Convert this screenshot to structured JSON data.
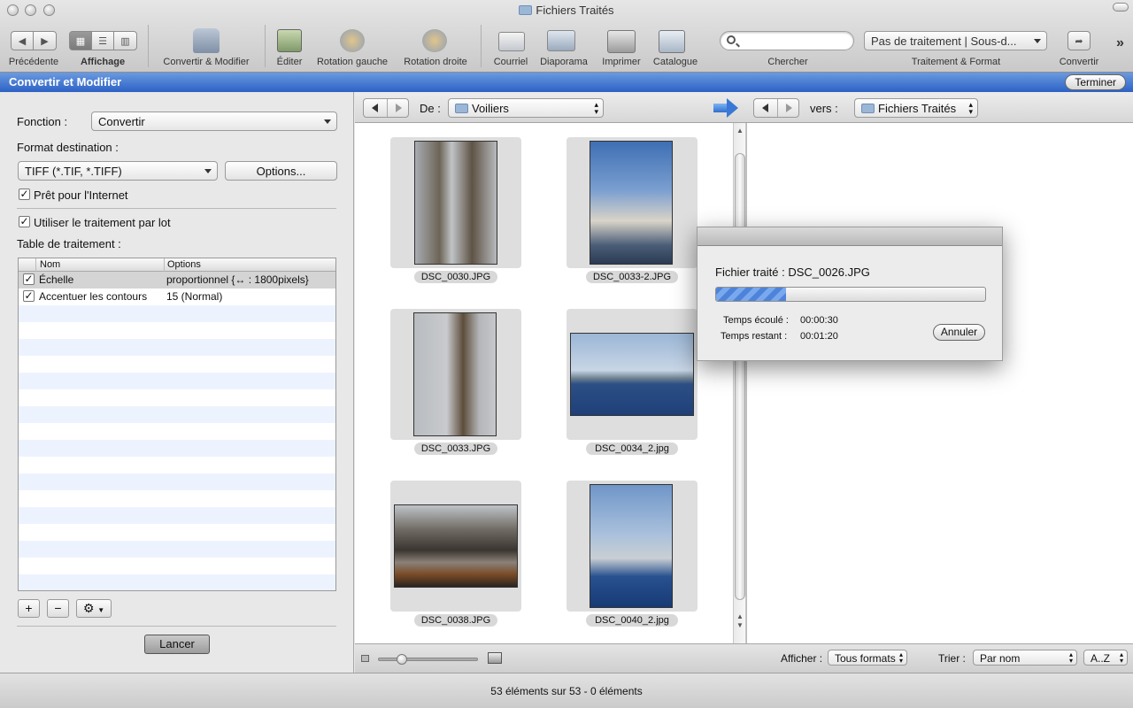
{
  "window": {
    "title": "Fichiers Traités"
  },
  "toolbar": {
    "back_label": "Précédente",
    "view_label": "Affichage",
    "convert_modify_label": "Convertir & Modifier",
    "edit_label": "Éditer",
    "rotate_left_label": "Rotation gauche",
    "rotate_right_label": "Rotation droite",
    "mail_label": "Courriel",
    "slideshow_label": "Diaporama",
    "print_label": "Imprimer",
    "catalog_label": "Catalogue",
    "search_label": "Chercher",
    "search_placeholder": "",
    "treatment_select": "Pas de traitement | Sous-d...",
    "treatment_label": "Traitement & Format",
    "convert_label": "Convertir",
    "more_glyph": "»"
  },
  "panel": {
    "title": "Convertir et Modifier",
    "done_button": "Terminer",
    "function_label": "Fonction :",
    "function_value": "Convertir",
    "format_label": "Format destination :",
    "format_value": "TIFF (*.TIF, *.TIFF)",
    "options_button": "Options...",
    "internet_label": "Prêt pour l'Internet",
    "batch_label": "Utiliser le traitement par lot",
    "table_label": "Table de traitement :",
    "columns": [
      "Nom",
      "Options"
    ],
    "rows": [
      {
        "name": "Échelle",
        "options": "proportionnel {↔ : 1800pixels}",
        "checked": true
      },
      {
        "name": "Accentuer les contours",
        "options": "15 (Normal)",
        "checked": true
      }
    ],
    "add_button": "+",
    "remove_button": "−",
    "gear_button": "⚙",
    "run_button": "Lancer"
  },
  "source": {
    "from_label": "De :",
    "folder": "Voiliers"
  },
  "dest": {
    "to_label": "vers :",
    "folder": "Fichiers Traités"
  },
  "thumbnails": [
    {
      "name": "DSC_0030.JPG"
    },
    {
      "name": "DSC_0033-2.JPG"
    },
    {
      "name": "DSC_0033.JPG"
    },
    {
      "name": "DSC_0034_2.jpg"
    },
    {
      "name": "DSC_0038.JPG"
    },
    {
      "name": "DSC_0040_2.jpg"
    }
  ],
  "bottom": {
    "show_label": "Afficher :",
    "show_value": "Tous formats",
    "sort_label": "Trier :",
    "sort_value": "Par nom",
    "order_value": "A..Z",
    "zoom_fraction": 0.18
  },
  "status": {
    "text": "53 éléments sur 53 - 0 éléments"
  },
  "dialog": {
    "file_line": "Fichier traité : DSC_0026.JPG",
    "elapsed_label": "Temps écoulé :",
    "elapsed_value": "00:00:30",
    "remaining_label": "Temps restant :",
    "remaining_value": "00:01:20",
    "cancel_button": "Annuler",
    "progress": 0.26
  },
  "colors": {
    "accent": "#2f64c6"
  }
}
